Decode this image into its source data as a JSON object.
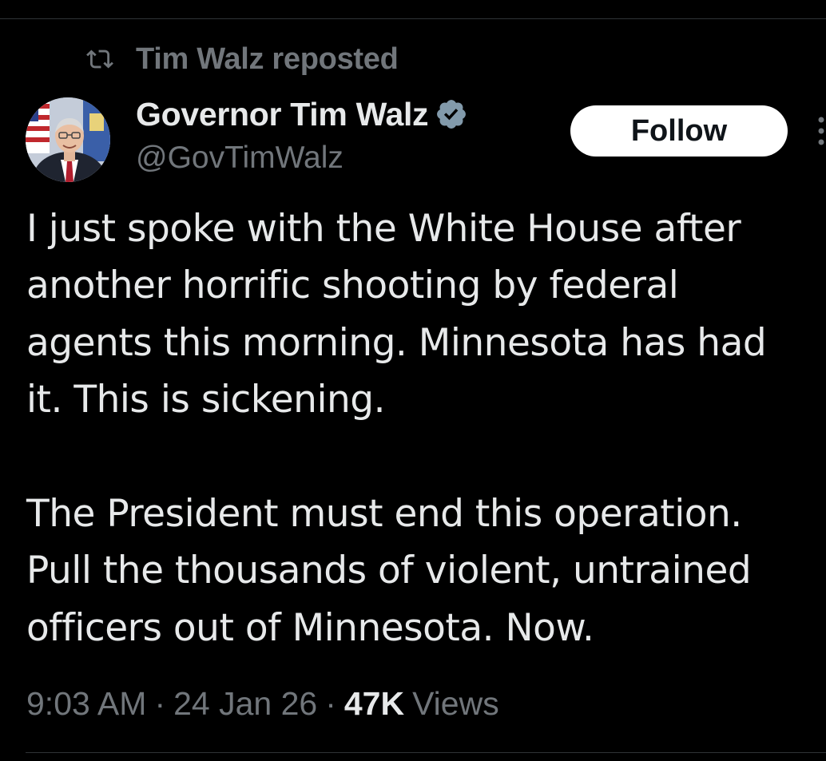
{
  "repost": {
    "label": "Tim Walz reposted",
    "icon": "repost-icon"
  },
  "author": {
    "display_name": "Governor Tim Walz",
    "handle": "@GovTimWalz",
    "verified_icon": "verified-badge-icon",
    "avatar_icon": "avatar"
  },
  "follow_button": {
    "label": "Follow"
  },
  "more_menu": {
    "icon": "more-options-icon"
  },
  "tweet": {
    "lines": [
      "I just spoke with the White House after",
      "another horrific shooting by federal",
      "agents this morning. Minnesota has had",
      "it. This is sickening.",
      "",
      "The President must end this operation.",
      "Pull the thousands of violent, untrained",
      "officers out of Minnesota. Now."
    ]
  },
  "meta": {
    "time": "9:03 AM",
    "separator": "·",
    "date": "24 Jan 26",
    "views_count": "47K",
    "views_label": "Views"
  },
  "colors": {
    "background": "#000000",
    "primary_text": "#e7e9ea",
    "secondary_text": "#71767b",
    "verified_blue": "#1d9bf0",
    "follow_bg": "#ffffff",
    "divider": "#2f3336"
  }
}
